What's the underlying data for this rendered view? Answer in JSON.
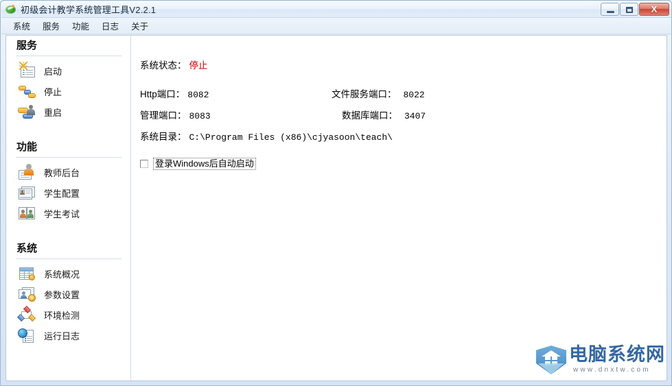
{
  "window": {
    "title": "初级会计教学系统管理工具V2.2.1",
    "icon": "green-disc-icon",
    "controls": {
      "minimize": "minimize-icon",
      "maximize": "maximize-icon",
      "close": "X"
    }
  },
  "menubar": {
    "items": [
      {
        "label": "系统"
      },
      {
        "label": "服务"
      },
      {
        "label": "功能"
      },
      {
        "label": "日志"
      },
      {
        "label": "关于"
      }
    ]
  },
  "sidebar": {
    "groups": [
      {
        "title": "服务",
        "items": [
          {
            "label": "启动",
            "icon": "service-start-icon"
          },
          {
            "label": "停止",
            "icon": "service-stop-icon"
          },
          {
            "label": "重启",
            "icon": "service-restart-icon"
          }
        ]
      },
      {
        "title": "功能",
        "items": [
          {
            "label": "教师后台",
            "icon": "teacher-console-icon"
          },
          {
            "label": "学生配置",
            "icon": "student-config-icon"
          },
          {
            "label": "学生考试",
            "icon": "student-exam-icon"
          }
        ]
      },
      {
        "title": "系统",
        "items": [
          {
            "label": "系统概况",
            "icon": "system-overview-icon"
          },
          {
            "label": "参数设置",
            "icon": "parameter-settings-icon"
          },
          {
            "label": "环境检测",
            "icon": "environment-check-icon"
          },
          {
            "label": "运行日志",
            "icon": "runtime-log-icon"
          }
        ]
      }
    ]
  },
  "main": {
    "status": {
      "label": "系统状态：",
      "value": "停止",
      "value_color": "#cc0000"
    },
    "fields": [
      {
        "label": "Http端口：",
        "value": "8082"
      },
      {
        "label": "管理端口：",
        "value": "8083"
      },
      {
        "label": "文件服务端口：",
        "value": "8022"
      },
      {
        "label": "数据库端口：",
        "value": "3407"
      }
    ],
    "directory": {
      "label": "系统目录：",
      "value": "C:\\Program Files (x86)\\cjyasoon\\teach\\"
    },
    "autostart": {
      "label": "登录Windows后自动启动",
      "checked": false
    }
  },
  "watermark": {
    "text": "电脑系统网",
    "url": "www.dnxtw.com"
  }
}
